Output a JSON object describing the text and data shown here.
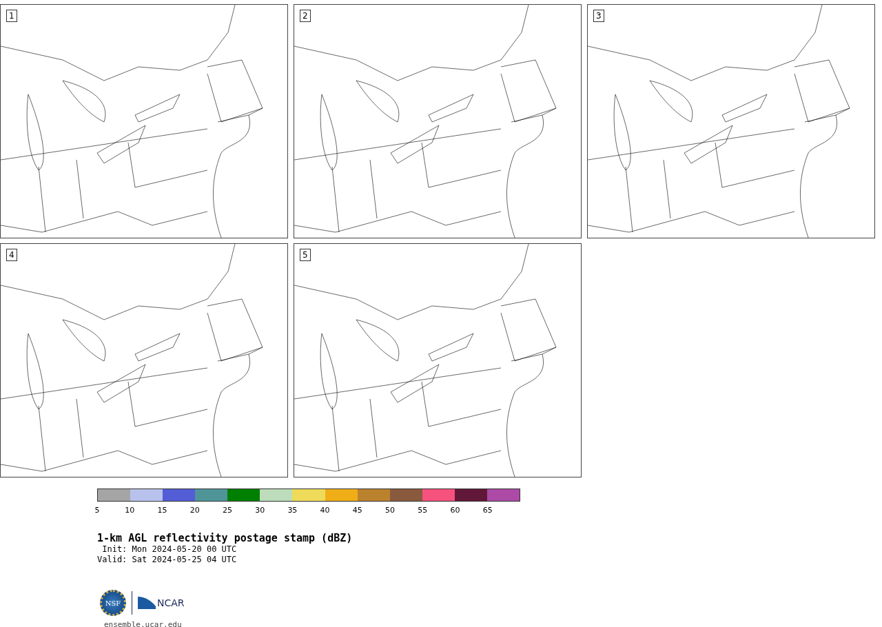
{
  "panels": [
    {
      "label": "1"
    },
    {
      "label": "2"
    },
    {
      "label": "3"
    },
    {
      "label": "4"
    },
    {
      "label": "5"
    }
  ],
  "colorbar": {
    "bins": [
      {
        "color": "#a5a5a5"
      },
      {
        "color": "#b8c2ec"
      },
      {
        "color": "#535dd6"
      },
      {
        "color": "#4f9598"
      },
      {
        "color": "#008000"
      },
      {
        "color": "#bddcbb"
      },
      {
        "color": "#efdb5a"
      },
      {
        "color": "#efae17"
      },
      {
        "color": "#bb822e"
      },
      {
        "color": "#8a5a3e"
      },
      {
        "color": "#f5527d"
      },
      {
        "color": "#611838"
      },
      {
        "color": "#ac4aa5"
      }
    ],
    "ticks": [
      "5",
      "10",
      "15",
      "20",
      "25",
      "30",
      "35",
      "40",
      "45",
      "50",
      "55",
      "60",
      "65"
    ]
  },
  "title": "1-km AGL reflectivity postage stamp (dBZ)",
  "init": " Init: Mon 2024-05-20 00 UTC",
  "valid": "Valid: Sat 2024-05-25 04 UTC",
  "logos": {
    "nsf": "NSF",
    "ncar": "NCAR"
  },
  "url": "ensemble.ucar.edu"
}
